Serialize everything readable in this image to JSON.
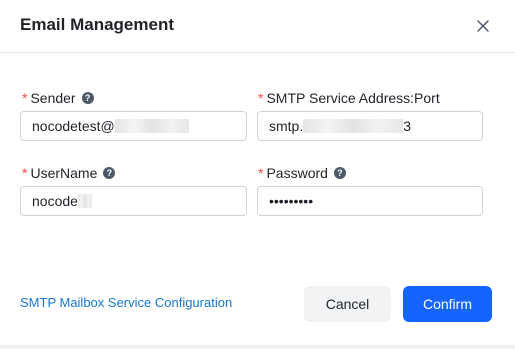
{
  "dialog": {
    "title": "Email Management",
    "close_icon": "close-icon"
  },
  "form": {
    "required_mark": "*",
    "help_icon_glyph": "?",
    "sender": {
      "label": "Sender",
      "value": "nocodetest@"
    },
    "smtp_address": {
      "label": "SMTP Service Address:Port",
      "value_prefix": "smtp.",
      "value_suffix": "3"
    },
    "username": {
      "label": "UserName",
      "value": "nocode"
    },
    "password": {
      "label": "Password",
      "value": "•••••••••"
    }
  },
  "footer": {
    "config_link": "SMTP Mailbox Service Configuration",
    "cancel_label": "Cancel",
    "confirm_label": "Confirm"
  },
  "colors": {
    "primary": "#1664ff",
    "link": "#1677d2",
    "required": "#f54a45"
  }
}
